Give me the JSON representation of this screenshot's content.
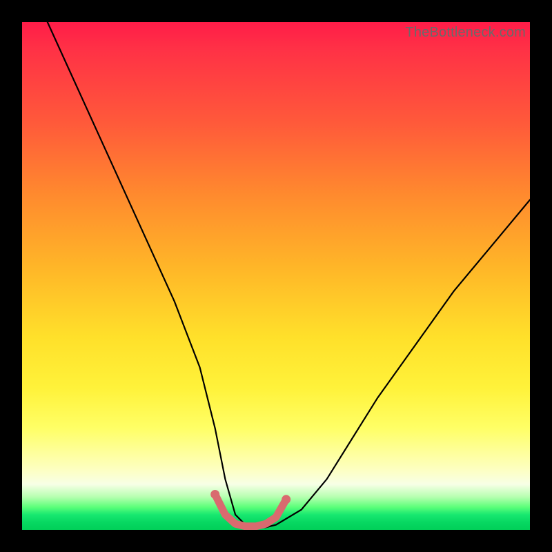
{
  "watermark": "TheBottleneck.com",
  "chart_data": {
    "type": "line",
    "title": "",
    "xlabel": "",
    "ylabel": "",
    "xlim": [
      0,
      100
    ],
    "ylim": [
      0,
      100
    ],
    "grid": false,
    "legend": false,
    "series": [
      {
        "name": "bottleneck-curve",
        "x": [
          5,
          10,
          15,
          20,
          25,
          30,
          35,
          38,
          40,
          42,
          44,
          46,
          48,
          50,
          55,
          60,
          65,
          70,
          75,
          80,
          85,
          90,
          95,
          100
        ],
        "values": [
          100,
          89,
          78,
          67,
          56,
          45,
          32,
          20,
          10,
          3,
          1,
          0.5,
          0.5,
          1,
          4,
          10,
          18,
          26,
          33,
          40,
          47,
          53,
          59,
          65
        ]
      },
      {
        "name": "optimal-zone-highlight",
        "x": [
          38,
          40,
          42,
          44,
          46,
          48,
          50,
          52
        ],
        "values": [
          7,
          3,
          1.2,
          0.7,
          0.7,
          1.2,
          2.5,
          6
        ]
      }
    ],
    "colors": {
      "curve": "#000000",
      "highlight": "#d96a6f",
      "gradient_top": "#ff1c48",
      "gradient_bottom": "#01cf58"
    }
  }
}
